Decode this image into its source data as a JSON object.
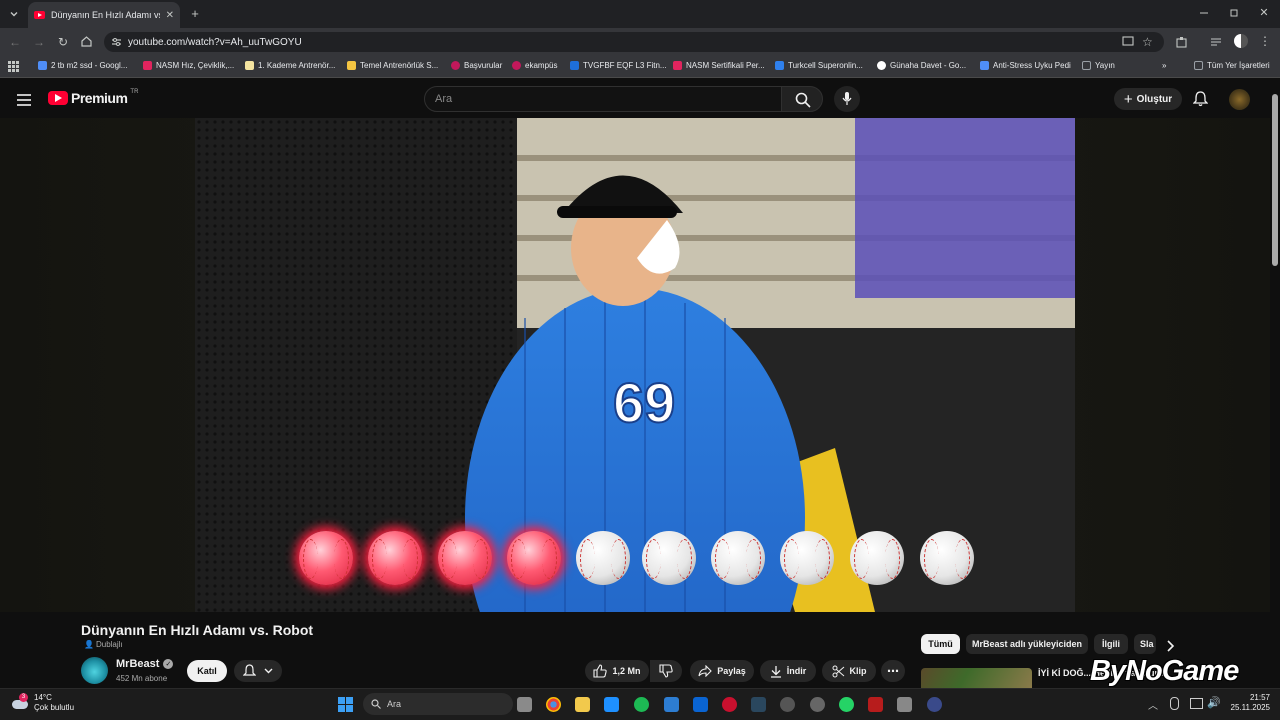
{
  "browser": {
    "tab_title": "Dünyanın En Hızlı Adamı vs. Ro",
    "url": "youtube.com/watch?v=Ah_uuTwGOYU",
    "bookmarks": [
      {
        "label": "2 tb m2 ssd - Googl...",
        "color": "#4f8ef7"
      },
      {
        "label": "NASM Hız, Çeviklik,...",
        "color": "#e0245e"
      },
      {
        "label": "1. Kademe Antrenör...",
        "color": "#f4e4a0"
      },
      {
        "label": "Temel Antrenörlük S...",
        "color": "#f4c542"
      },
      {
        "label": "Başvurular",
        "color": "#c2185b"
      },
      {
        "label": "ekampüs",
        "color": "#c2185b"
      },
      {
        "label": "TVGFBF EQF L3 Fitn...",
        "color": "#1e6fd9"
      },
      {
        "label": "NASM Sertifikali Per...",
        "color": "#e0245e"
      },
      {
        "label": "Turkcell Superonlin...",
        "color": "#2f80ed"
      },
      {
        "label": "Günaha Davet - Go...",
        "color": "#ffffff"
      },
      {
        "label": "Anti-Stress Uyku Pedi",
        "color": "#4f8ef7"
      },
      {
        "label": "Yayın",
        "color": "#9aa0a6"
      }
    ],
    "all_bookmarks": "Tüm Yer İşaretleri"
  },
  "youtube": {
    "logo_text": "Premium",
    "region": "TR",
    "search_placeholder": "Ara",
    "create_label": "Oluştur"
  },
  "video": {
    "jersey_number": "69",
    "balls": [
      "red",
      "red",
      "red",
      "red",
      "white",
      "white",
      "white",
      "white",
      "white",
      "white"
    ],
    "title": "Dünyanın En Hızlı Adamı vs. Robot",
    "dub_label": "Dublajlı"
  },
  "channel": {
    "name": "MrBeast",
    "subscribers": "452 Mn abone",
    "join_label": "Katıl"
  },
  "actions": {
    "like_count": "1,2 Mn",
    "share": "Paylaş",
    "download": "İndir",
    "clip": "Klip"
  },
  "chips": [
    "Tümü",
    "MrBeast adlı yükleyiciden",
    "İlgili",
    "Sla"
  ],
  "related": {
    "title": "İYİ Kİ DOĞ... Hediye yağmuru"
  },
  "watermark": "ByNoGame",
  "taskbar": {
    "temperature": "14°C",
    "weather_desc": "Çok bulutlu",
    "weather_badge": "3",
    "search_placeholder": "Ara",
    "time": "21:57",
    "date": "25.11.2025"
  }
}
